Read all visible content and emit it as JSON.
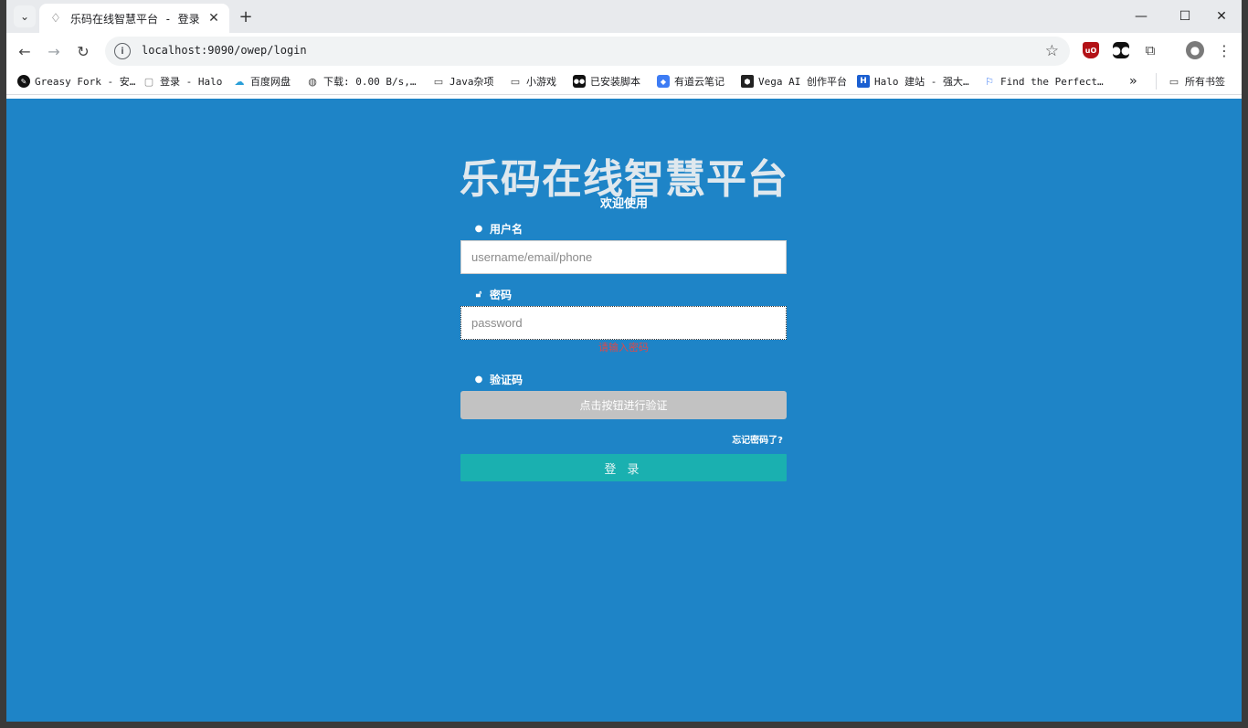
{
  "tab": {
    "title": "乐码在线智慧平台 - 登录"
  },
  "address_bar": {
    "url": "localhost:9090/owep/login"
  },
  "bookmarks": [
    {
      "label": "Greasy Fork - 安…",
      "icon": "greasyfork-icon"
    },
    {
      "label": "登录 - Halo",
      "icon": "halo-icon"
    },
    {
      "label": "百度网盘",
      "icon": "baidu-netdisk-icon"
    },
    {
      "label": "下载: 0.00 B/s,…",
      "icon": "globe-icon"
    },
    {
      "label": "Java杂项",
      "icon": "folder-icon"
    },
    {
      "label": "小游戏",
      "icon": "folder-icon"
    },
    {
      "label": "已安装脚本",
      "icon": "tampermonkey-icon"
    },
    {
      "label": "有道云笔记",
      "icon": "youdao-icon"
    },
    {
      "label": "Vega AI 创作平台",
      "icon": "vega-icon"
    },
    {
      "label": "Halo 建站 - 强大…",
      "icon": "halo-h-icon"
    },
    {
      "label": "Find the Perfect…",
      "icon": "flag-icon"
    }
  ],
  "bookmarks_more": "»",
  "all_bookmarks_label": "所有书签",
  "login": {
    "title": "乐码在线智慧平台",
    "subtitle": "欢迎使用",
    "username_label": "用户名",
    "username_placeholder": "username/email/phone",
    "password_label": "密码",
    "password_placeholder": "password",
    "password_error": "请输入密码",
    "captcha_label": "验证码",
    "captcha_button": "点击按钮进行验证",
    "forgot_password": "忘记密码了?",
    "login_button": "登 录"
  },
  "colors": {
    "page_background": "#1e84c7",
    "login_button": "#1ab0b0",
    "captcha_button": "#c2c2c2",
    "error_text": "#e04848"
  }
}
